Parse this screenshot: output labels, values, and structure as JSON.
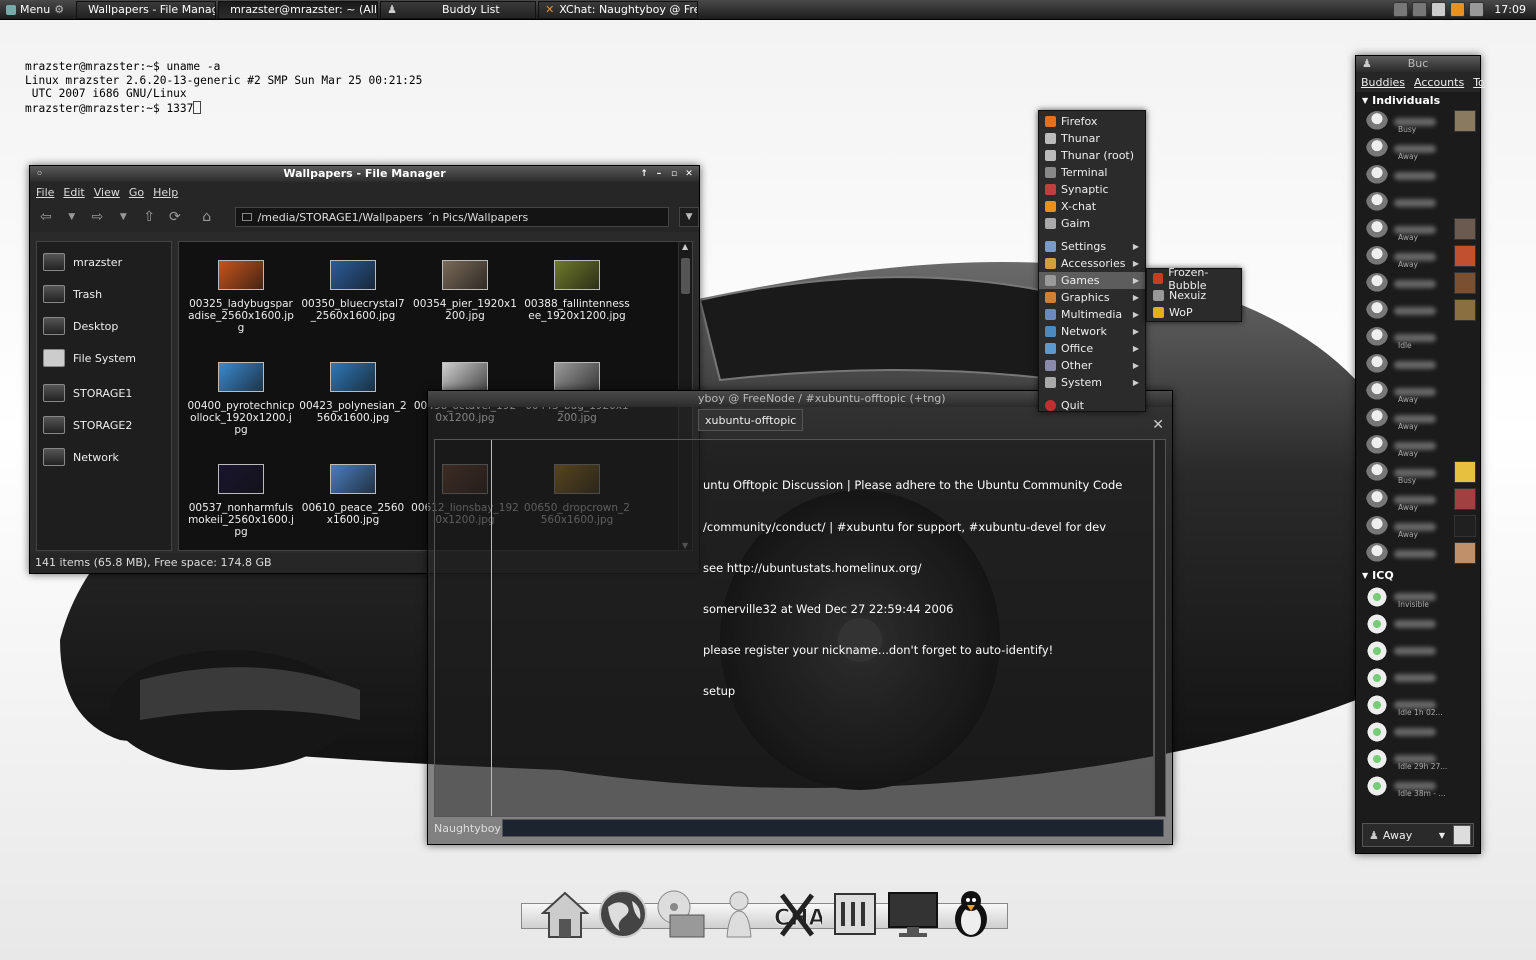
{
  "top_panel": {
    "menu_label": "Menu",
    "tasks": [
      "Wallpapers - File Manager",
      "mrazster@mrazster: ~ (All...",
      "Buddy List",
      "XChat: Naughtyboy @ Fre..."
    ],
    "clock": "17:09"
  },
  "terminal": {
    "lines": [
      "mrazster@mrazster:~$ uname -a",
      "Linux mrazster 2.6.20-13-generic #2 SMP Sun Mar 25 00:21:25",
      " UTC 2007 i686 GNU/Linux",
      "mrazster@mrazster:~$ 1337"
    ]
  },
  "file_manager": {
    "title": "Wallpapers - File Manager",
    "menu": [
      "File",
      "Edit",
      "View",
      "Go",
      "Help"
    ],
    "path": "/media/STORAGE1/Wallpapers ´n Pics/Wallpapers",
    "places": [
      "mrazster",
      "Trash",
      "Desktop",
      "File System"
    ],
    "volumes": [
      "STORAGE1",
      "STORAGE2",
      "Network"
    ],
    "files": [
      {
        "name": "00325_ladybugsparadise_2560x1600.jpg",
        "color": "#c8541c"
      },
      {
        "name": "00350_bluecrystal7_2560x1600.jpg",
        "color": "#2b5d9a"
      },
      {
        "name": "00354_pier_1920x1200.jpg",
        "color": "#7a6a58"
      },
      {
        "name": "00388_fallintenness ee_1920x1200.jpg",
        "color": "#6f7a2a"
      },
      {
        "name": "00400_pyrotechnicpollock_1920x1200.jpg",
        "color": "#3a8ad0"
      },
      {
        "name": "00423_polynesian_2560x1600.jpg",
        "color": "#2f78b8"
      },
      {
        "name": "00438_octavei_1920x1200.jpg",
        "color": "#cfcfcf"
      },
      {
        "name": "00443_bug_1920x1200.jpg",
        "color": "#9a9a9a"
      },
      {
        "name": "00537_nonharmfulsmokeii_2560x1600.jpg",
        "color": "#1a1530"
      },
      {
        "name": "00610_peace_2560x1600.jpg",
        "color": "#4a7fbf"
      },
      {
        "name": "00612_lionsbay_1920x1200.jpg",
        "color": "#8a4a30"
      },
      {
        "name": "00650_dropcrown_2560x1600.jpg",
        "color": "#e0a020"
      }
    ],
    "status": "141 items (65.8 MB), Free space: 174.8 GB"
  },
  "xchat": {
    "title": "yboy @ FreeNode / #xubuntu-offtopic (+tng)",
    "tab": "xubuntu-offtopic",
    "lines": [
      "untu Offtopic Discussion | Please adhere to the Ubuntu Community Code",
      "/community/conduct/ | #xubuntu for support, #xubuntu-devel for dev",
      "see http://ubuntustats.homelinux.org/",
      "somerville32 at Wed Dec 27 22:59:44 2006",
      "please register your nickname...don't forget to auto-identify!",
      "setup"
    ],
    "nick": "Naughtyboy"
  },
  "app_menu": {
    "items": [
      {
        "label": "Firefox",
        "color": "#e8701a"
      },
      {
        "label": "Thunar",
        "color": "#bbbbbb"
      },
      {
        "label": "Thunar (root)",
        "color": "#bbbbbb"
      },
      {
        "label": "Terminal",
        "color": "#888888"
      },
      {
        "label": "Synaptic",
        "color": "#c04040"
      },
      {
        "label": "X-chat",
        "color": "#e89020"
      },
      {
        "label": "Gaim",
        "color": "#aaaaaa"
      }
    ],
    "categories": [
      {
        "label": "Settings",
        "color": "#7a9ac8"
      },
      {
        "label": "Accessories",
        "color": "#d0a040"
      },
      {
        "label": "Games",
        "color": "#9a9a9a"
      },
      {
        "label": "Graphics",
        "color": "#d08030"
      },
      {
        "label": "Multimedia",
        "color": "#6a8ac0"
      },
      {
        "label": "Network",
        "color": "#4a8ac0"
      },
      {
        "label": "Office",
        "color": "#5a9ad0"
      },
      {
        "label": "Other",
        "color": "#8a8aaa"
      },
      {
        "label": "System",
        "color": "#aaaaaa"
      }
    ],
    "quit": "Quit",
    "games_submenu": [
      {
        "label": "Frozen-Bubble",
        "color": "#c04020"
      },
      {
        "label": "Nexuiz",
        "color": "#999999"
      },
      {
        "label": "WoP",
        "color": "#e0b020"
      }
    ]
  },
  "buddy_list": {
    "title": "Buc",
    "menu": [
      "Buddies",
      "Accounts",
      "To"
    ],
    "group_individuals": "Individuals",
    "individuals": [
      {
        "status": "Busy",
        "avatar": "#8a7a60"
      },
      {
        "status": "Away",
        "avatar": ""
      },
      {
        "status": "",
        "avatar": ""
      },
      {
        "status": "",
        "avatar": ""
      },
      {
        "status": "Away",
        "avatar": "#6a5a50"
      },
      {
        "status": "Away",
        "avatar": "#c05030"
      },
      {
        "status": "",
        "avatar": "#7a5030"
      },
      {
        "status": "",
        "avatar": "#8a7040"
      },
      {
        "status": "Idle",
        "avatar": ""
      },
      {
        "status": "",
        "avatar": ""
      },
      {
        "status": "Away",
        "avatar": ""
      },
      {
        "status": "Away",
        "avatar": ""
      },
      {
        "status": "Away",
        "avatar": ""
      },
      {
        "status": "Busy",
        "avatar": "#e8c040"
      },
      {
        "status": "Away",
        "avatar": "#a04040"
      },
      {
        "status": "Away",
        "avatar": "#202020"
      },
      {
        "status": "",
        "avatar": "#c0906a"
      }
    ],
    "group_icq": "ICQ",
    "icq": [
      {
        "status": "Invisible"
      },
      {
        "status": ""
      },
      {
        "status": ""
      },
      {
        "status": ""
      },
      {
        "status": "Idle 1h 02..."
      },
      {
        "status": ""
      },
      {
        "status": "Idle 29h 27..."
      },
      {
        "status": "Idle 38m - ..."
      }
    ],
    "status_selector": "Away"
  },
  "dock": {
    "icons": [
      "home-icon",
      "globe-icon",
      "drives-icon",
      "gaim-icon",
      "xchat-icon",
      "mixer-icon",
      "monitor-icon",
      "tux-icon"
    ]
  }
}
